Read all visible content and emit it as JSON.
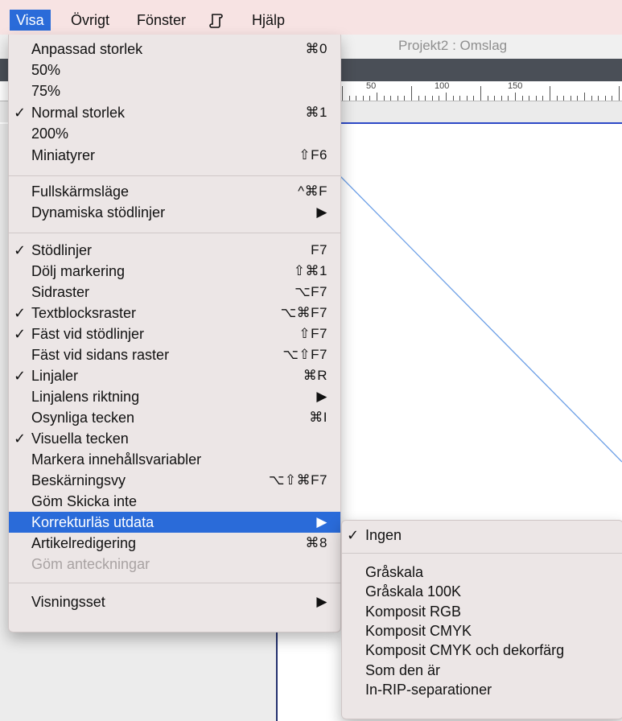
{
  "menubar": {
    "items": [
      {
        "label": "Visa",
        "active": true
      },
      {
        "label": "Övrigt"
      },
      {
        "label": "Fönster"
      },
      {
        "label": "Hjälp"
      }
    ],
    "script_icon": "script-menu-icon"
  },
  "window": {
    "title": "Projekt2 : Omslag"
  },
  "ruler": {
    "labels": [
      "50",
      "100",
      "150"
    ]
  },
  "menu": {
    "items": [
      {
        "label": "Anpassad storlek",
        "shortcut": "⌘0",
        "checked": false
      },
      {
        "label": "50%",
        "shortcut": "",
        "checked": false
      },
      {
        "label": "75%",
        "shortcut": "",
        "checked": false
      },
      {
        "label": "Normal storlek",
        "shortcut": "⌘1",
        "checked": true
      },
      {
        "label": "200%",
        "shortcut": "",
        "checked": false
      },
      {
        "label": "Miniatyrer",
        "shortcut": "⇧F6",
        "checked": false
      },
      {
        "label": "Fullskärmsläge",
        "shortcut": "^⌘F",
        "checked": false
      },
      {
        "label": "Dynamiska stödlinjer",
        "shortcut": "▶",
        "checked": false
      },
      {
        "label": "Stödlinjer",
        "shortcut": "F7",
        "checked": true
      },
      {
        "label": "Dölj markering",
        "shortcut": "⇧⌘1",
        "checked": false
      },
      {
        "label": "Sidraster",
        "shortcut": "⌥F7",
        "checked": false
      },
      {
        "label": "Textblocksraster",
        "shortcut": "⌥⌘F7",
        "checked": true
      },
      {
        "label": "Fäst vid stödlinjer",
        "shortcut": "⇧F7",
        "checked": true
      },
      {
        "label": "Fäst vid sidans raster",
        "shortcut": "⌥⇧F7",
        "checked": false
      },
      {
        "label": "Linjaler",
        "shortcut": "⌘R",
        "checked": true
      },
      {
        "label": "Linjalens riktning",
        "shortcut": "▶",
        "checked": false
      },
      {
        "label": "Osynliga tecken",
        "shortcut": "⌘I",
        "checked": false
      },
      {
        "label": "Visuella tecken",
        "shortcut": "",
        "checked": true
      },
      {
        "label": "Markera innehållsvariabler",
        "shortcut": "",
        "checked": false
      },
      {
        "label": "Beskärningsvy",
        "shortcut": "⌥⇧⌘F7",
        "checked": false
      },
      {
        "label": "Göm Skicka inte",
        "shortcut": "",
        "checked": false
      },
      {
        "label": "Korrekturläs utdata",
        "shortcut": "▶",
        "checked": false,
        "highlighted": true
      },
      {
        "label": "Artikelredigering",
        "shortcut": "⌘8",
        "checked": false
      },
      {
        "label": "Göm anteckningar",
        "shortcut": "",
        "checked": false,
        "disabled": true
      },
      {
        "label": "Visningsset",
        "shortcut": "▶",
        "checked": false
      }
    ],
    "check_glyph": "✓"
  },
  "submenu": {
    "items": [
      {
        "label": "Ingen",
        "checked": true
      },
      {
        "label": "Gråskala"
      },
      {
        "label": "Gråskala 100K"
      },
      {
        "label": "Komposit RGB"
      },
      {
        "label": "Komposit CMYK"
      },
      {
        "label": "Komposit CMYK och dekorfärg"
      },
      {
        "label": "Som den är"
      },
      {
        "label": "In-RIP-separationer"
      }
    ]
  },
  "colors": {
    "highlight": "#2a6bd9",
    "menubar_bg": "#f7e3e3",
    "menu_bg": "#ece6e6",
    "page_edge": "#2d49c7"
  }
}
